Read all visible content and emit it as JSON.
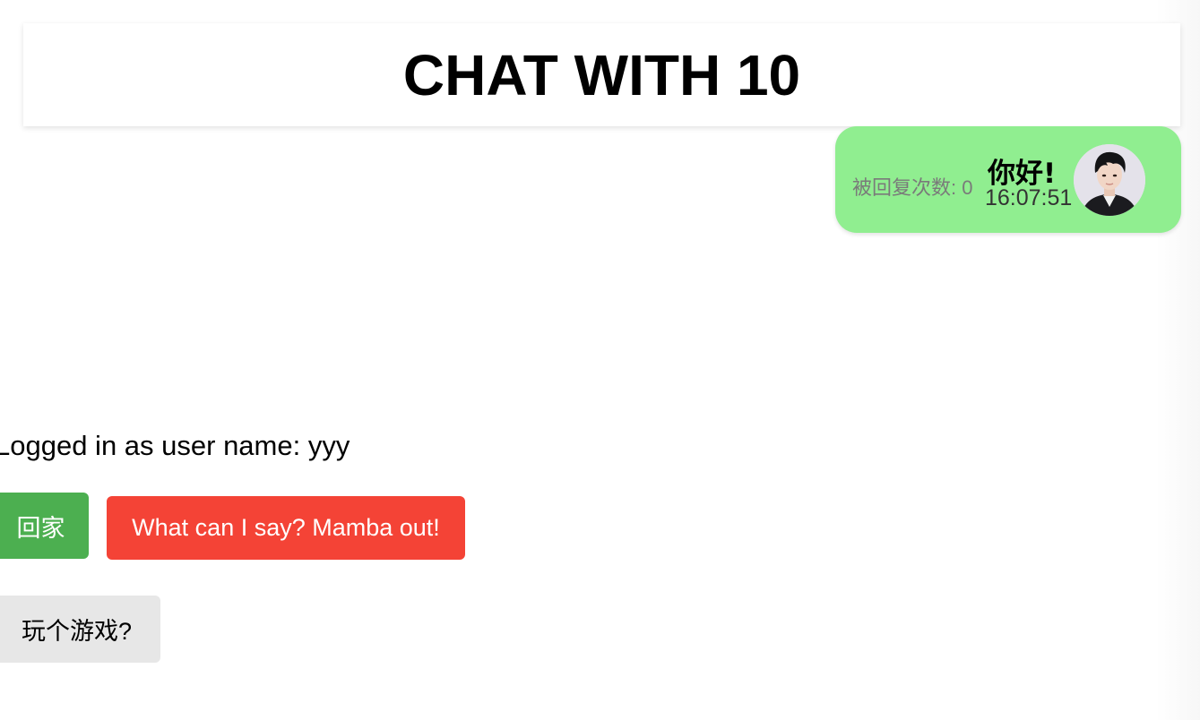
{
  "header": {
    "title": "CHAT WITH 10"
  },
  "message": {
    "reply_count": "被回复次数: 0",
    "text": "你好!",
    "time": "16:07:51",
    "avatar_icon": "user-avatar-photo",
    "bubble_color": "#90ee90"
  },
  "user": {
    "login_text": "Logged in as user name: yyy"
  },
  "buttons": {
    "home_label": "回家",
    "home_color": "#4caf50",
    "mamba_label": "What can I say? Mamba out!",
    "mamba_color": "#f44336",
    "game_label": "玩个游戏?",
    "game_color": "#e7e7e7"
  }
}
